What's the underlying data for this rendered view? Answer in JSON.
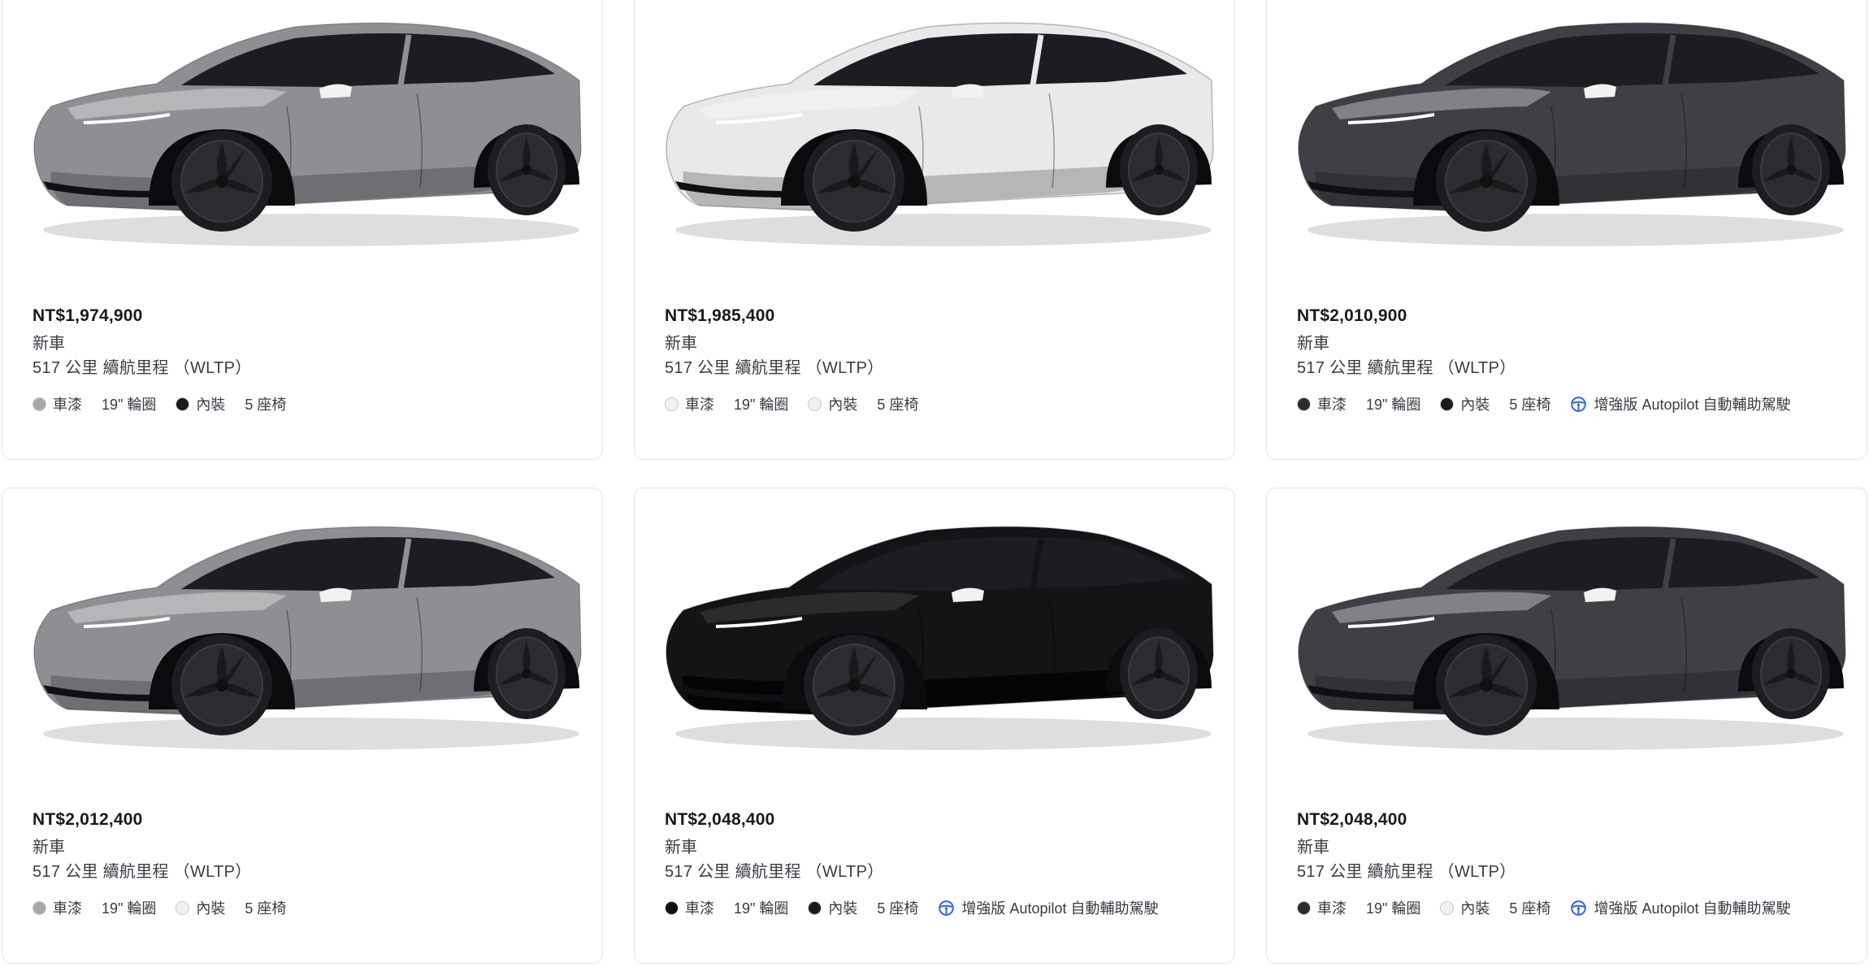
{
  "cards": [
    {
      "price": "NT$1,974,900",
      "condition": "新車",
      "range": "517 公里 續航里程 （WLTP）",
      "paint_label": "車漆",
      "wheels_label": "19\" 輪圈",
      "interior_label": "內裝",
      "seats_label": "5 座椅",
      "autopilot_label": "",
      "body_color": "#8e8f92",
      "paint_swatch": "#a8a8aa",
      "interior_swatch": "#1a1a1a"
    },
    {
      "price": "NT$1,985,400",
      "condition": "新車",
      "range": "517 公里 續航里程 （WLTP）",
      "paint_label": "車漆",
      "wheels_label": "19\" 輪圈",
      "interior_label": "內裝",
      "seats_label": "5 座椅",
      "autopilot_label": "",
      "body_color": "#e9e9e9",
      "paint_swatch": "#f2f2f2",
      "interior_swatch": "#f0f0f0"
    },
    {
      "price": "NT$2,010,900",
      "condition": "新車",
      "range": "517 公里 續航里程 （WLTP）",
      "paint_label": "車漆",
      "wheels_label": "19\" 輪圈",
      "interior_label": "內裝",
      "seats_label": "5 座椅",
      "autopilot_label": "增強版 Autopilot 自動輔助駕駛",
      "body_color": "#3e4045",
      "paint_swatch": "#2c2d31",
      "interior_swatch": "#1a1a1a"
    },
    {
      "price": "NT$2,012,400",
      "condition": "新車",
      "range": "517 公里 續航里程 （WLTP）",
      "paint_label": "車漆",
      "wheels_label": "19\" 輪圈",
      "interior_label": "內裝",
      "seats_label": "5 座椅",
      "autopilot_label": "",
      "body_color": "#8e8f92",
      "paint_swatch": "#a8a8aa",
      "interior_swatch": "#f0f0f0"
    },
    {
      "price": "NT$2,048,400",
      "condition": "新車",
      "range": "517 公里 續航里程 （WLTP）",
      "paint_label": "車漆",
      "wheels_label": "19\" 輪圈",
      "interior_label": "內裝",
      "seats_label": "5 座椅",
      "autopilot_label": "增強版 Autopilot 自動輔助駕駛",
      "body_color": "#141416",
      "paint_swatch": "#111111",
      "interior_swatch": "#1a1a1a"
    },
    {
      "price": "NT$2,048,400",
      "condition": "新車",
      "range": "517 公里 續航里程 （WLTP）",
      "paint_label": "車漆",
      "wheels_label": "19\" 輪圈",
      "interior_label": "內裝",
      "seats_label": "5 座椅",
      "autopilot_label": "增強版 Autopilot 自動輔助駕駛",
      "body_color": "#3e4045",
      "paint_swatch": "#2c2d31",
      "interior_swatch": "#f0f0f0"
    }
  ],
  "icons": {
    "autopilot": "steering-wheel-icon"
  },
  "colors": {
    "accent_blue": "#3e6ae1",
    "border": "#e4e4e4"
  }
}
